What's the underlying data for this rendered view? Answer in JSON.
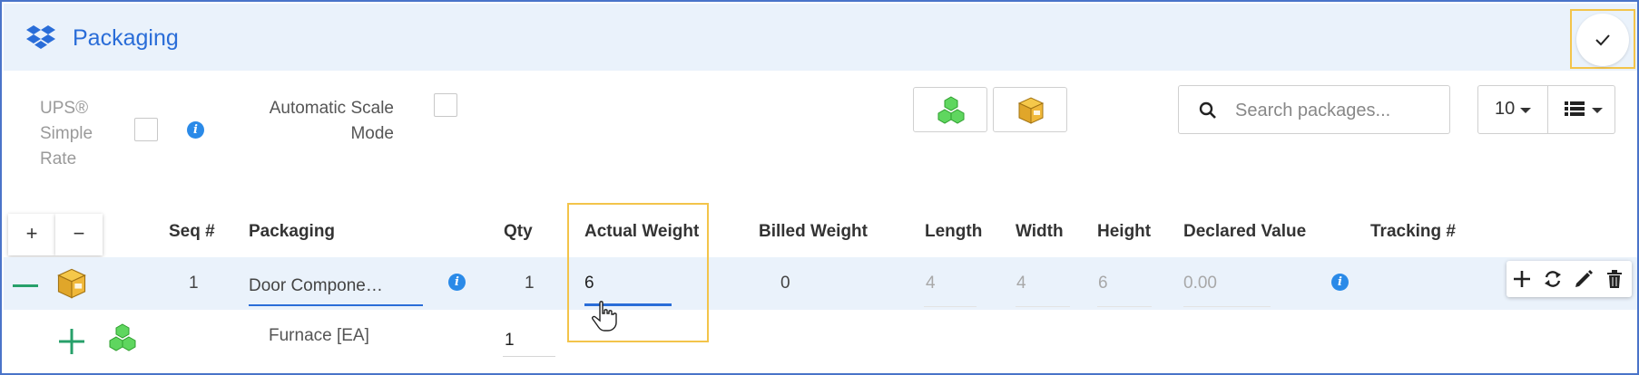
{
  "header": {
    "title": "Packaging",
    "logo_icon": "dropbox-icon",
    "confirm_icon": "check-icon"
  },
  "toolbar": {
    "ups_simple_rate_label": "UPS® Simple Rate",
    "ups_simple_rate_checked": false,
    "automatic_scale_label": "Automatic Scale Mode",
    "automatic_scale_checked": false,
    "add_items_icon": "green-boxes-icon",
    "add_package_icon": "yellow-box-icon",
    "search": {
      "placeholder": "Search packages...",
      "value": ""
    },
    "page_size": "10",
    "view_icon": "list-view-icon"
  },
  "table": {
    "expand_label": "+",
    "collapse_label": "−",
    "columns": [
      "Seq #",
      "Packaging",
      "Qty",
      "Actual Weight",
      "Billed Weight",
      "Length",
      "Width",
      "Height",
      "Declared Value",
      "Tracking #"
    ],
    "rows": [
      {
        "seq": "1",
        "packaging": "Door Compone…",
        "qty": "1",
        "actual_weight": "6",
        "billed_weight": "0",
        "length": "4",
        "width": "4",
        "height": "6",
        "declared_value": "0.00",
        "tracking": "",
        "items": [
          {
            "name": "Furnace [EA]",
            "qty": "1"
          }
        ]
      }
    ],
    "row_actions": [
      "add-icon",
      "refresh-icon",
      "edit-icon",
      "trash-icon"
    ]
  },
  "colors": {
    "accent": "#2a6dd8",
    "header_bg": "#eaf2fb",
    "highlight": "#f3c44a",
    "green": "#27a06a",
    "info": "#2a8ae8"
  }
}
